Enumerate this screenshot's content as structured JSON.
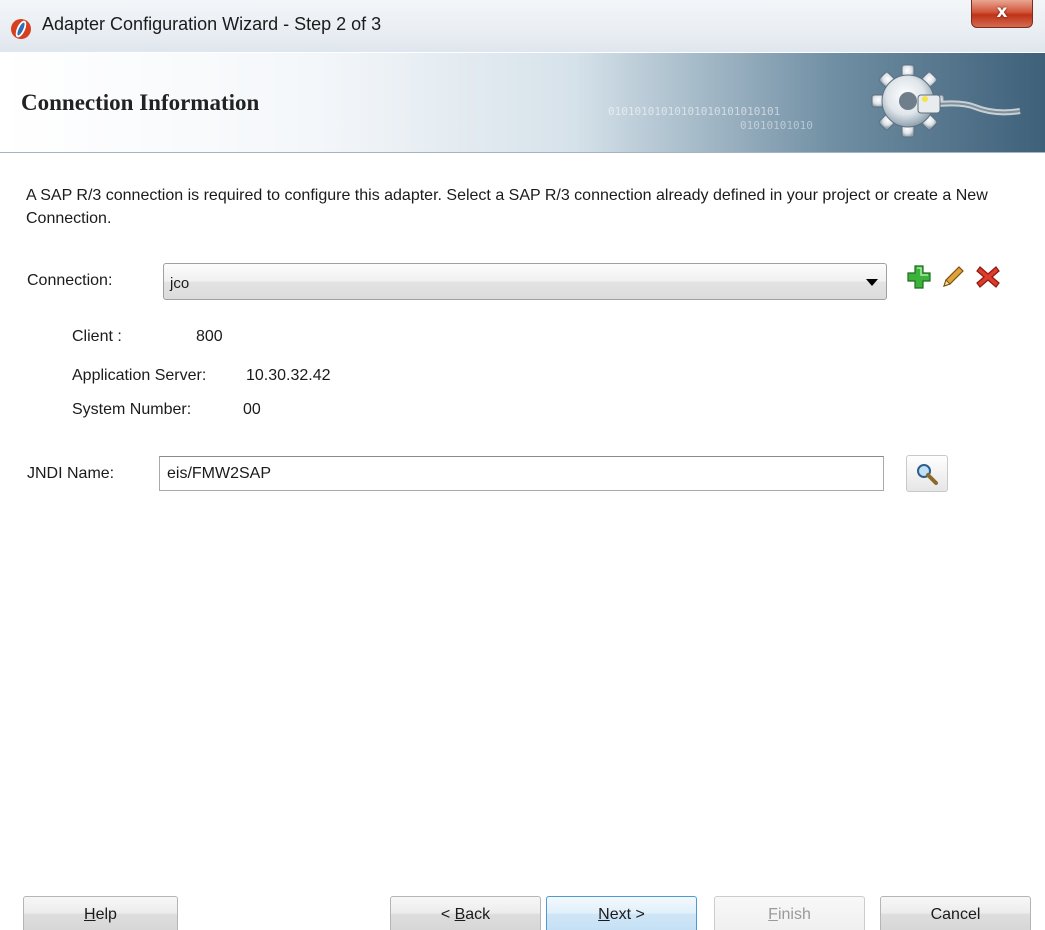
{
  "window": {
    "title": "Adapter Configuration Wizard - Step 2 of 3",
    "close_glyph": "x"
  },
  "header": {
    "heading": "Connection Information",
    "binary_line1": "01010101010101010101010101",
    "binary_line2": "01010101010",
    "graphic_icon": "gear-plug-icon"
  },
  "content": {
    "description": "A SAP R/3 connection is required to configure this adapter. Select a SAP R/3 connection already defined in your project or create a New Connection.",
    "connection_label": "Connection:",
    "connection_value": "jco",
    "icons": {
      "add": "add-icon",
      "edit": "pencil-icon",
      "delete": "delete-icon"
    },
    "details": [
      {
        "label": "Client :",
        "value": "800"
      },
      {
        "label": "Application Server:",
        "value": "10.30.32.42"
      },
      {
        "label": "System Number:",
        "value": "00"
      }
    ],
    "jndi_label": "JNDI Name:",
    "jndi_value": "eis/FMW2SAP",
    "browse_icon": "search-icon"
  },
  "footer": {
    "help": {
      "pre": "",
      "mnemonic": "H",
      "post": "elp"
    },
    "back": {
      "pre": "< ",
      "mnemonic": "B",
      "post": "ack"
    },
    "next": {
      "pre": "",
      "mnemonic": "N",
      "post": "ext >"
    },
    "finish": {
      "pre": "",
      "mnemonic": "F",
      "post": "inish"
    },
    "cancel": {
      "pre": "",
      "mnemonic": "",
      "post": "Cancel"
    }
  },
  "colors": {
    "add": "#2fa52f",
    "edit": "#c78a1c",
    "delete": "#d12b1e",
    "next_border": "#4f9bd1"
  }
}
